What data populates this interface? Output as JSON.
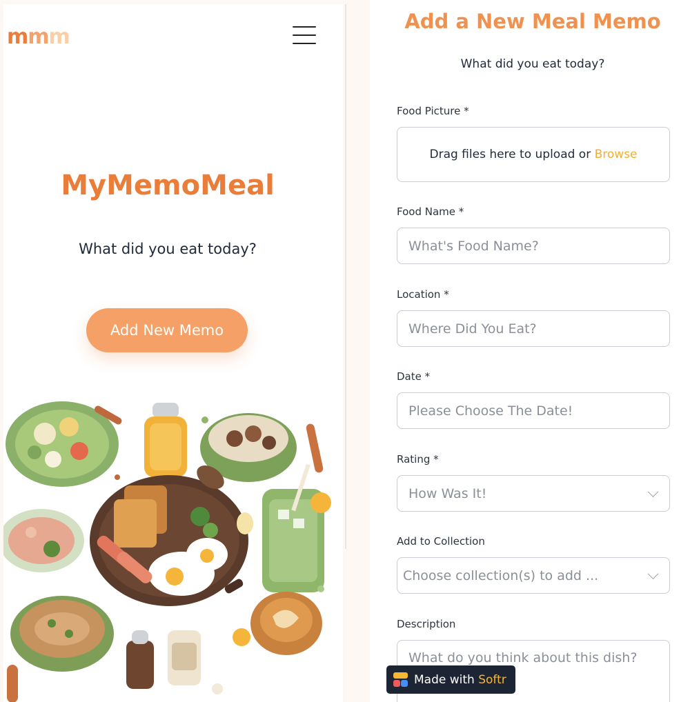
{
  "left": {
    "logo": [
      "m",
      "m",
      "m"
    ],
    "title": "MyMemoMeal",
    "subtitle": "What did you eat today?",
    "add_button": "Add New Memo"
  },
  "form": {
    "title": "Add a New Meal Memo",
    "subtitle": "What did you eat today?",
    "food_picture": {
      "label": "Food Picture *",
      "upload_text": "Drag files here to upload or ",
      "browse": "Browse"
    },
    "food_name": {
      "label": "Food Name *",
      "placeholder": "What's Food Name?"
    },
    "location": {
      "label": "Location *",
      "placeholder": "Where Did You Eat?"
    },
    "date": {
      "label": "Date *",
      "placeholder": "Please Choose The Date!"
    },
    "rating": {
      "label": "Rating *",
      "placeholder": "How Was It!"
    },
    "collection": {
      "label": "Add to Collection",
      "placeholder": "Choose collection(s) to add ..."
    },
    "description": {
      "label": "Description",
      "placeholder": "What do you think about this dish?"
    }
  },
  "badge": {
    "prefix": "Made with ",
    "brand": "Softr"
  },
  "colors": {
    "accent": "#ea7d3a",
    "button": "#f4a066",
    "browse": "#f0b030",
    "badge_bg": "#1d2535"
  },
  "icons": [
    "menu-icon",
    "chevron-down-icon",
    "softr-logo-icon"
  ]
}
